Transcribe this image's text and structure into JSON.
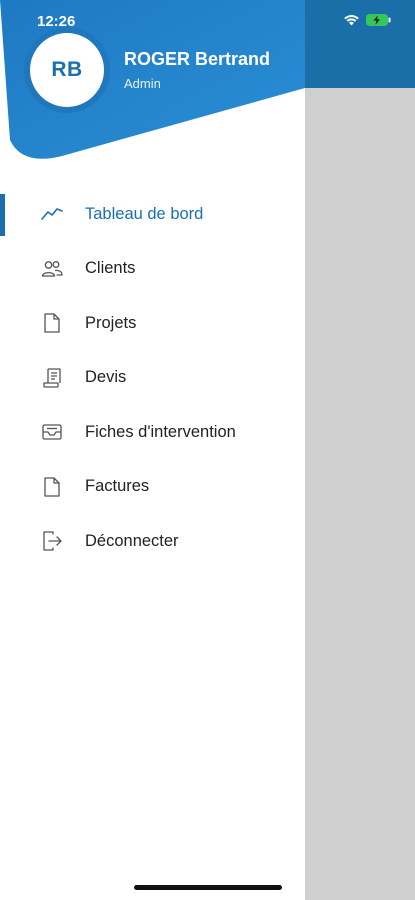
{
  "status_bar": {
    "time": "12:26"
  },
  "user": {
    "initials": "RB",
    "name": "ROGER Bertrand",
    "role": "Admin"
  },
  "colors": {
    "header_blue": "#1f78bd",
    "accent": "#1b6fae",
    "overlay": "#cfcfcf"
  },
  "menu": {
    "active_index": 0,
    "items": [
      {
        "label": "Tableau de bord",
        "icon": "trend-line-icon"
      },
      {
        "label": "Clients",
        "icon": "users-icon"
      },
      {
        "label": "Projets",
        "icon": "document-icon"
      },
      {
        "label": "Devis",
        "icon": "receipt-icon"
      },
      {
        "label": "Fiches d'intervention",
        "icon": "inbox-icon"
      },
      {
        "label": "Factures",
        "icon": "document-icon"
      },
      {
        "label": "Déconnecter",
        "icon": "logout-icon"
      }
    ]
  }
}
